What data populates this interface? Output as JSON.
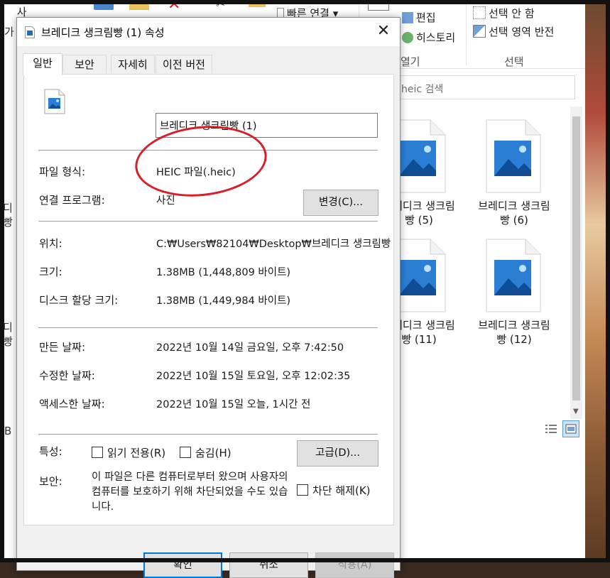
{
  "explorer": {
    "ribbon": {
      "copy_label": "복사",
      "quick_connect_label": "빠른 연결 ▾",
      "edit_label": "편집",
      "history_label": "히스토리",
      "open_group_label": "열기",
      "select_none_label": "선택 안 함",
      "invert_selection_label": "선택 영역 반전",
      "select_group_label": "선택"
    },
    "search_placeholder": "heic 검색",
    "left_strip": [
      "가",
      "디",
      "빵",
      "디",
      "빵",
      "B"
    ],
    "files": [
      {
        "line1": "브레디크 생크림",
        "line2": "빵 (5)"
      },
      {
        "line1": "브레디크 생크림",
        "line2": "빵 (6)"
      },
      {
        "line1": "브레디크 생크림",
        "line2": "빵 (11)"
      },
      {
        "line1": "브레디크 생크림",
        "line2": "빵 (12)"
      }
    ]
  },
  "dialog": {
    "title": "브레디크 생크림빵 (1) 속성",
    "close_glyph": "✕",
    "tabs": [
      "일반",
      "보안",
      "자세히",
      "이전 버전"
    ],
    "file_name": "브레디크 생크림빵 (1)",
    "file_type_label": "파일 형식:",
    "file_type_value": "HEIC 파일(.heic)",
    "opens_with_label": "연결 프로그램:",
    "opens_with_value": "사진",
    "change_button": "변경(C)...",
    "location_label": "위치:",
    "location_value": "C:₩Users₩82104₩Desktop₩브레디크 생크림빵",
    "size_label": "크기:",
    "size_value": "1.38MB (1,448,809 바이트)",
    "size_on_disk_label": "디스크 할당 크기:",
    "size_on_disk_value": "1.38MB (1,449,984 바이트)",
    "created_label": "만든 날짜:",
    "created_value": "2022년 10월 14일 금요일, 오후 7:42:50",
    "modified_label": "수정한 날짜:",
    "modified_value": "2022년 10월 15일 토요일, 오후 12:02:35",
    "accessed_label": "액세스한 날짜:",
    "accessed_value": "2022년 10월 15일 오늘, 1시간 전",
    "attributes_label": "특성:",
    "readonly_label": "읽기 전용(R)",
    "hidden_label": "숨김(H)",
    "advanced_button": "고급(D)...",
    "security_label": "보안:",
    "security_text": "이 파일은 다른 컴퓨터로부터 왔으며 사용자의 컴퓨터를 보호하기 위해 차단되었을 수도 있습니다.",
    "unblock_label": "차단 해제(K)",
    "ok_button": "확인",
    "cancel_button": "취소",
    "apply_button": "적용(A)"
  },
  "colors": {
    "annotation_ellipse": "#d81e2a",
    "focus_border": "#0078d7",
    "icon_blue": "#1e6fc0"
  }
}
